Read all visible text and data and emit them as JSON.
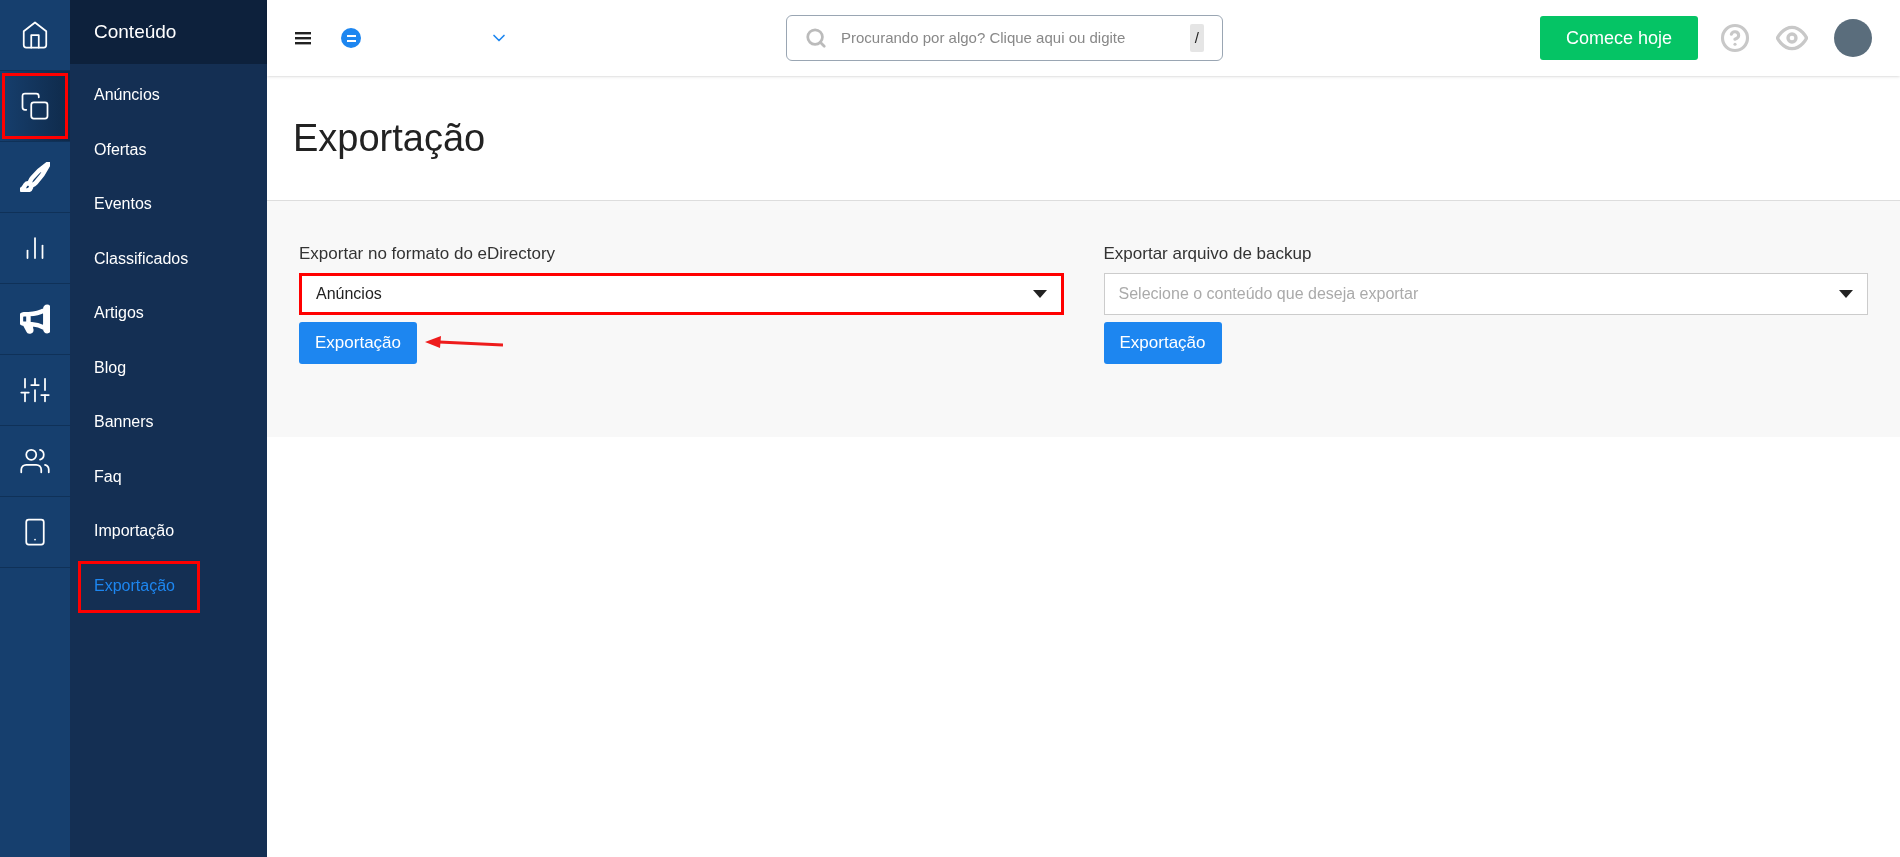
{
  "rail": [
    {
      "kind": "home",
      "selected": false,
      "highlighted": false
    },
    {
      "kind": "documents",
      "selected": true,
      "highlighted": true
    },
    {
      "kind": "brush",
      "selected": false,
      "highlighted": false
    },
    {
      "kind": "chart",
      "selected": false,
      "highlighted": false
    },
    {
      "kind": "megaphone",
      "selected": false,
      "highlighted": false
    },
    {
      "kind": "sliders",
      "selected": false,
      "highlighted": false
    },
    {
      "kind": "users",
      "selected": false,
      "highlighted": false
    },
    {
      "kind": "mobile",
      "selected": false,
      "highlighted": false
    }
  ],
  "submenu": {
    "title": "Conteúdo",
    "items": [
      {
        "label": "Anúncios",
        "selected": false,
        "highlighted": false
      },
      {
        "label": "Ofertas",
        "selected": false,
        "highlighted": false
      },
      {
        "label": "Eventos",
        "selected": false,
        "highlighted": false
      },
      {
        "label": "Classificados",
        "selected": false,
        "highlighted": false
      },
      {
        "label": "Artigos",
        "selected": false,
        "highlighted": false
      },
      {
        "label": "Blog",
        "selected": false,
        "highlighted": false
      },
      {
        "label": "Banners",
        "selected": false,
        "highlighted": false
      },
      {
        "label": "Faq",
        "selected": false,
        "highlighted": false
      },
      {
        "label": "Importação",
        "selected": false,
        "highlighted": false
      },
      {
        "label": "Exportação",
        "selected": true,
        "highlighted": true
      }
    ]
  },
  "topbar": {
    "search": {
      "placeholder": "Procurando por algo? Clique aqui ou digite",
      "shortcut": "/"
    },
    "cta": "Comece hoje"
  },
  "page_title": "Exportação",
  "panels": [
    {
      "label": "Exportar no formato do eDirectory",
      "value": "Anúncios",
      "highlighted": true,
      "button": "Exportação",
      "pointed": true
    },
    {
      "label": "Exportar arquivo de backup",
      "placeholder": "Selecione o conteúdo que deseja exportar",
      "highlighted": false,
      "button": "Exportação",
      "pointed": false
    }
  ]
}
